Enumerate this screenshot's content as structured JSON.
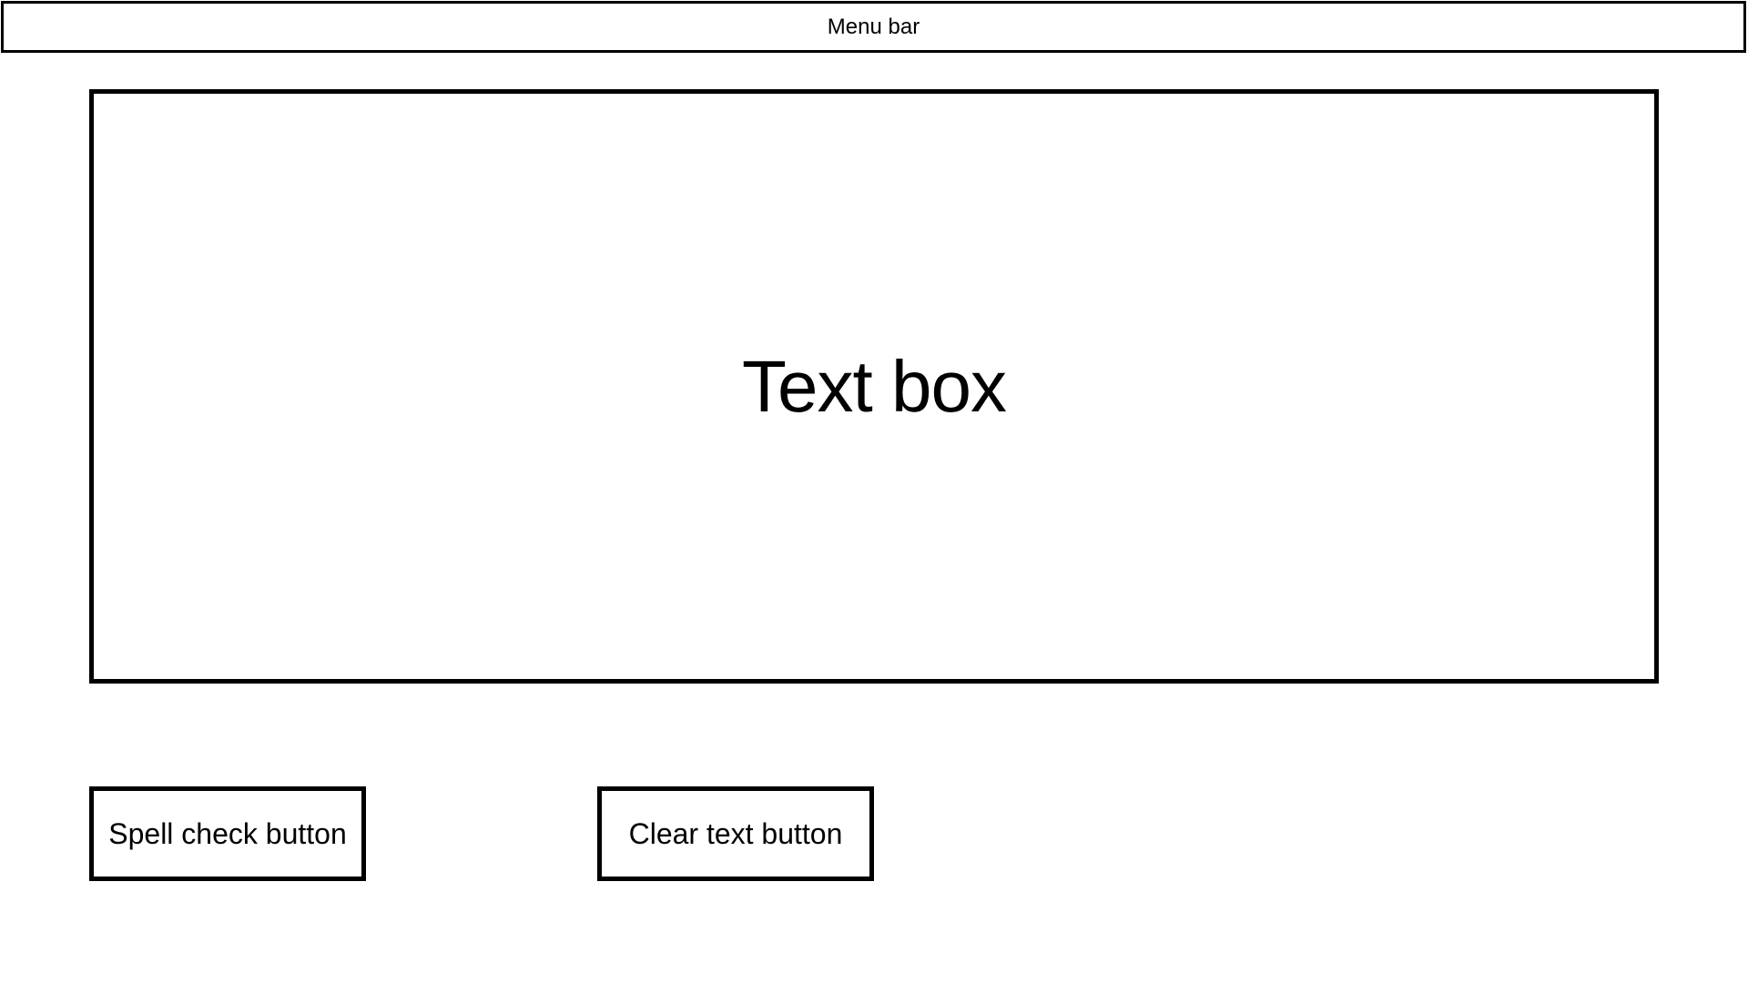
{
  "menu_bar": {
    "label": "Menu bar"
  },
  "main": {
    "text_box": {
      "label": "Text box"
    },
    "buttons": {
      "spell_check_label": "Spell check button",
      "clear_text_label": "Clear text button"
    }
  },
  "colors": {
    "border": "#000000",
    "background": "#ffffff",
    "text": "#000000"
  }
}
